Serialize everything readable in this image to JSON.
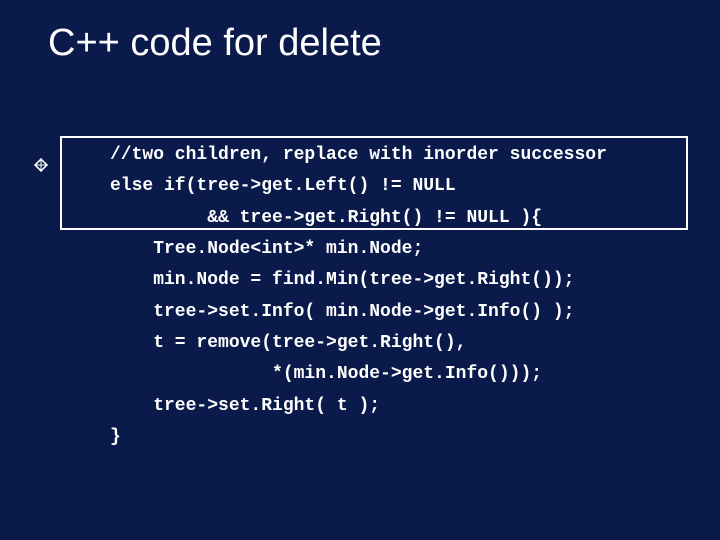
{
  "title": "C++ code for delete",
  "code": {
    "lines": [
      "//two children, replace with inorder successor",
      "else if(tree->get.Left() != NULL",
      "         && tree->get.Right() != NULL ){",
      "    Tree.Node<int>* min.Node;",
      "    min.Node = find.Min(tree->get.Right());",
      "    tree->set.Info( min.Node->get.Info() );",
      "    t = remove(tree->get.Right(),",
      "               *(min.Node->get.Info()));",
      "    tree->set.Right( t );",
      "}"
    ]
  }
}
